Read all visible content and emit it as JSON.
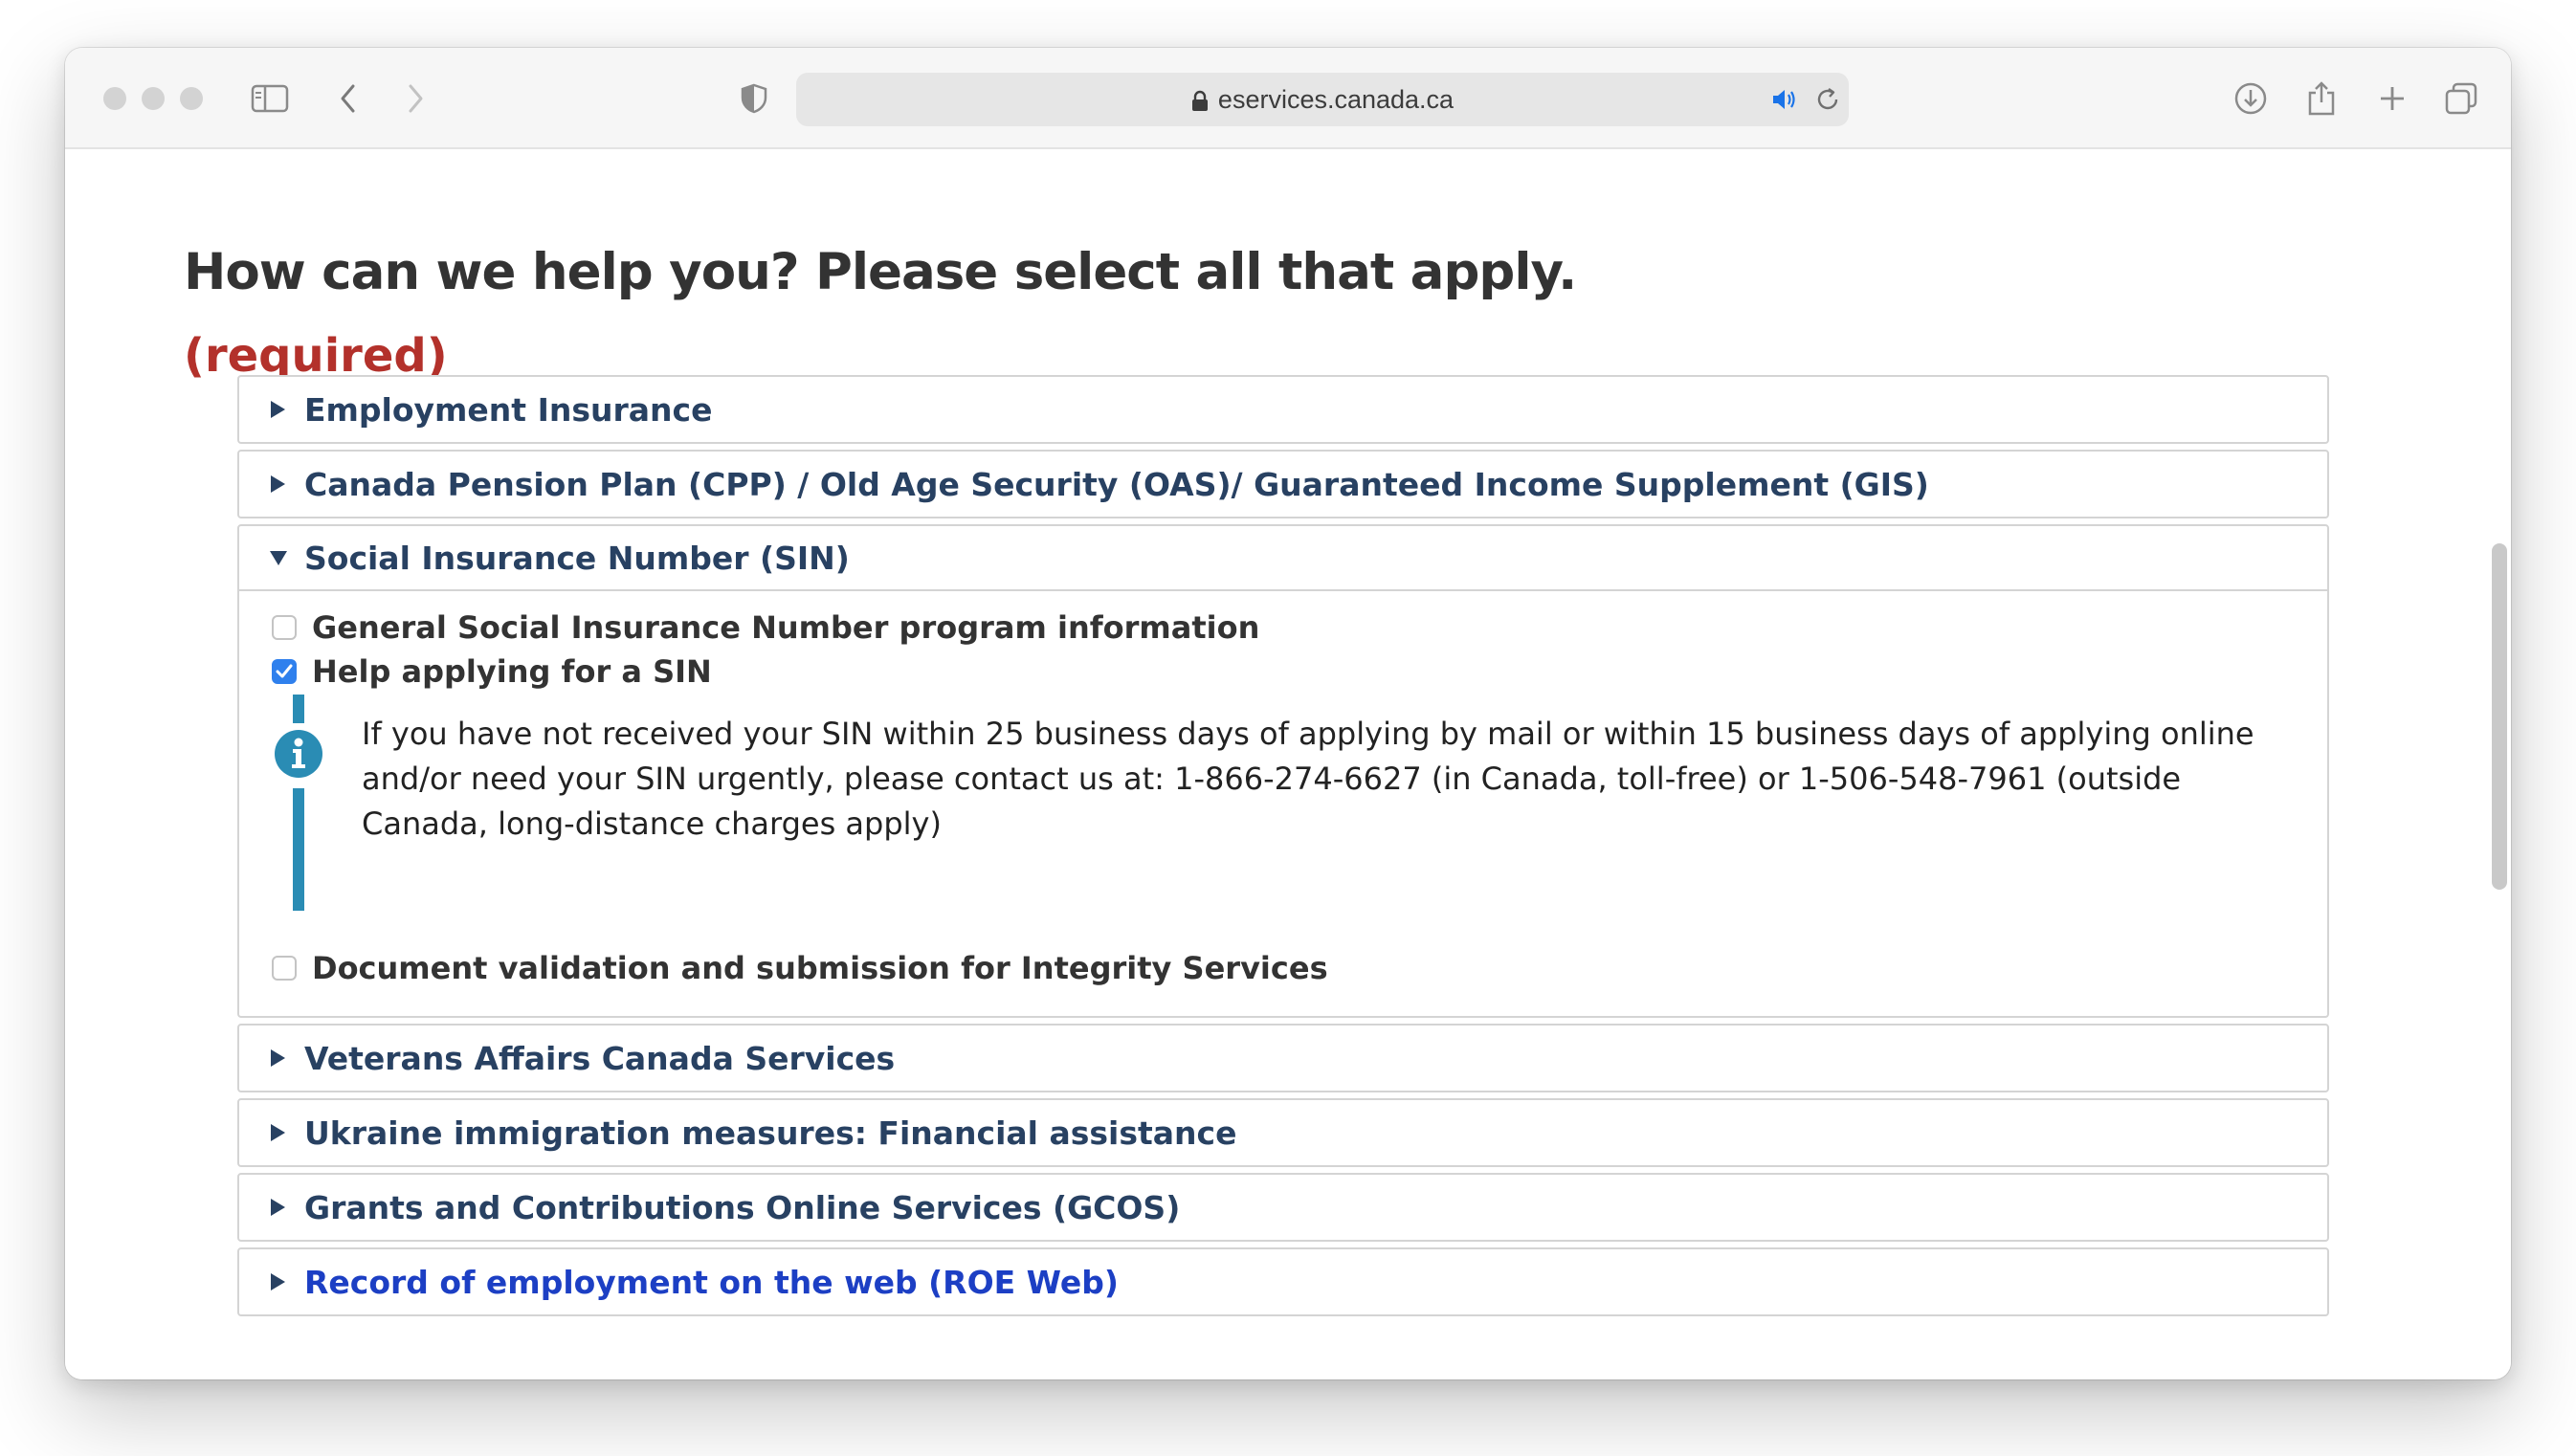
{
  "browser": {
    "url": "eservices.canada.ca",
    "icons": [
      "sidebar-icon",
      "back-icon",
      "forward-icon",
      "shield-icon",
      "lock-icon",
      "speaker-icon",
      "reload-icon",
      "download-icon",
      "share-icon",
      "new-tab-icon",
      "tabs-icon"
    ]
  },
  "page": {
    "title": "How can we help you? Please select all that apply.",
    "required": "(required)"
  },
  "sections": [
    {
      "label": "Employment Insurance",
      "expanded": false
    },
    {
      "label": "Canada Pension Plan (CPP) / Old Age Security (OAS)/ Guaranteed Income Supplement (GIS)",
      "expanded": false
    },
    {
      "label": "Social Insurance Number (SIN)",
      "expanded": true
    },
    {
      "label": "Veterans Affairs Canada Services",
      "expanded": false
    },
    {
      "label": "Ukraine immigration measures: Financial assistance",
      "expanded": false
    },
    {
      "label": "Grants and Contributions Online Services (GCOS)",
      "expanded": false
    },
    {
      "label": "Record of employment on the web (ROE Web)",
      "expanded": false
    }
  ],
  "sin": {
    "options": [
      {
        "label": "General Social Insurance Number program information",
        "checked": false
      },
      {
        "label": "Help applying for a SIN",
        "checked": true
      },
      {
        "label": "Document validation and submission for Integrity Services",
        "checked": false
      }
    ],
    "info": "If you have not received your SIN within 25 business days of applying by mail or within 15 business days of applying online and/or need your SIN urgently, please contact us at: 1-866-274-6627 (in Canada, toll-free) or 1-506-548-7961 (outside Canada, long-distance charges apply)"
  },
  "colors": {
    "heading": "#333333",
    "required": "#b3312b",
    "accordion_text": "#284162",
    "link": "#1c3fc4",
    "info_accent": "#2a8cb4",
    "checkbox_checked": "#2f80ed"
  }
}
